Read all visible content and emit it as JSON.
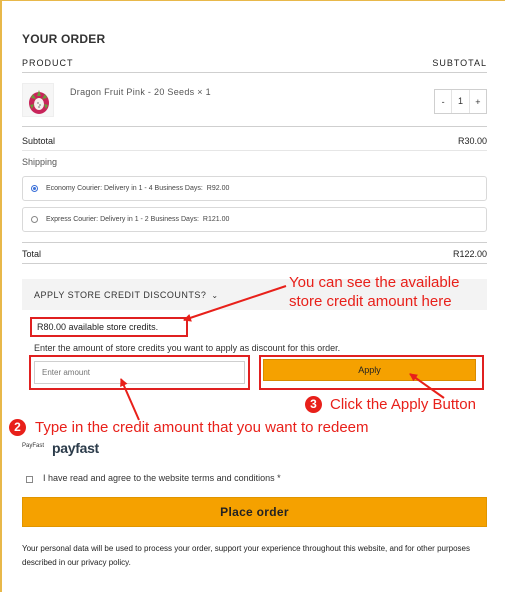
{
  "order": {
    "title": "YOUR ORDER",
    "col_product": "PRODUCT",
    "col_subtotal": "SUBTOTAL",
    "product_name": "Dragon Fruit Pink - 20 Seeds",
    "product_qty_label": "× 1",
    "qty_minus": "-",
    "qty_value": "1",
    "qty_plus": "+",
    "subtotal_label": "Subtotal",
    "subtotal_value": "R30.00",
    "shipping_label": "Shipping",
    "shipping_options": [
      {
        "label": "Economy Courier: Delivery in 1 - 4 Business Days:",
        "price": "R92.00",
        "selected": true
      },
      {
        "label": "Express Courier: Delivery in 1 - 2 Business Days:",
        "price": "R121.00",
        "selected": false
      }
    ],
    "total_label": "Total",
    "total_value": "R122.00"
  },
  "credit": {
    "toggle_label": "APPLY STORE CREDIT DISCOUNTS?",
    "available_text": "R80.00 available store credits.",
    "instruction": "Enter the amount of store credits you want to apply as discount for this order.",
    "input_placeholder": "Enter amount",
    "apply_label": "Apply"
  },
  "annotations": {
    "note1_line1": "You can see the available",
    "note1_line2": "store credit amount here",
    "badge2": "2",
    "note2": "Type in the credit amount that you want to redeem",
    "badge3": "3",
    "note3": "Click the Apply Button",
    "color": "#e8201a"
  },
  "payment": {
    "small_label": "PayFast",
    "logo_text": "payfast"
  },
  "checkout": {
    "terms_text": "I have read and agree to the website terms and conditions *",
    "place_order_label": "Place order",
    "privacy_text": "Your personal data will be used to process your order, support your experience throughout this website, and for other purposes described in our privacy policy.",
    "accent_color": "#f5a100"
  }
}
